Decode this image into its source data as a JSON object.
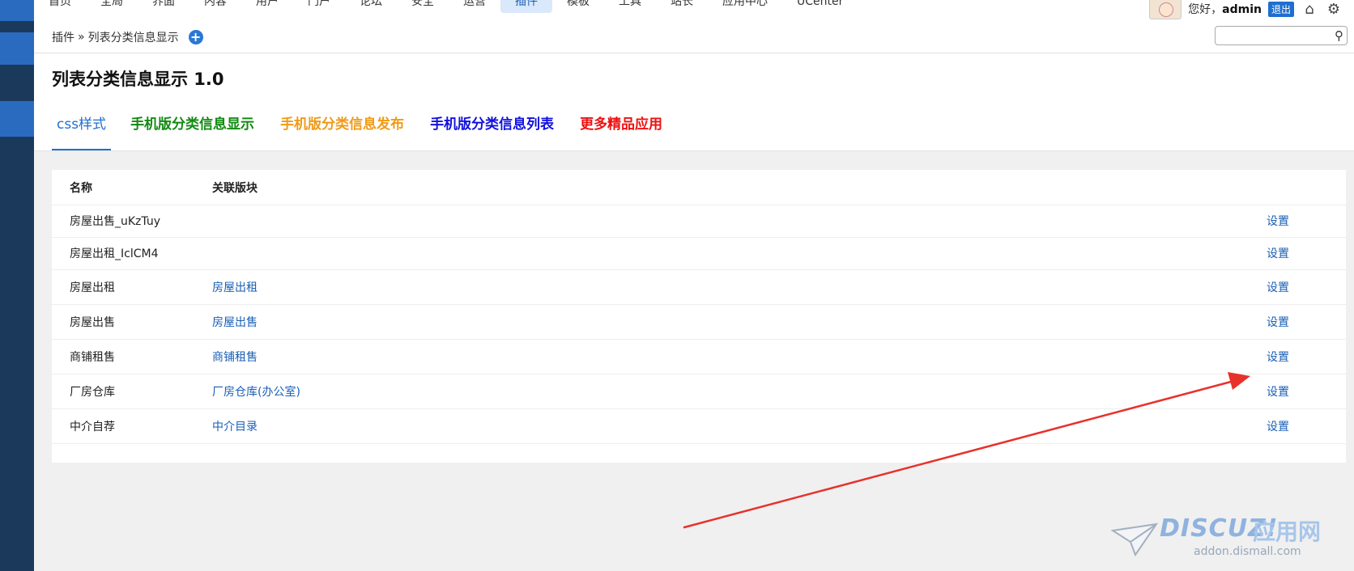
{
  "topnav": {
    "items": [
      "首页",
      "全局",
      "界面",
      "内容",
      "用户",
      "门户",
      "论坛",
      "安全",
      "运营",
      "插件",
      "模板",
      "工具",
      "站长",
      "应用中心",
      "UCenter"
    ],
    "active": "插件",
    "greeting": "您好，",
    "username": "admin",
    "logout": "退出"
  },
  "breadcrumb": {
    "parent": "插件",
    "separator": "»",
    "current": "列表分类信息显示"
  },
  "search": {
    "value": ""
  },
  "page": {
    "title": "列表分类信息显示 1.0"
  },
  "tabs": [
    {
      "label": "css样式",
      "color": "#1f6fd0"
    },
    {
      "label": "手机版分类信息显示",
      "color": "#118a11"
    },
    {
      "label": "手机版分类信息发布",
      "color": "#f09a16"
    },
    {
      "label": "手机版分类信息列表",
      "color": "#1010e0"
    },
    {
      "label": "更多精品应用",
      "color": "#ee1111"
    }
  ],
  "table": {
    "columns": [
      "名称",
      "关联版块"
    ],
    "rows": [
      {
        "name": "房屋出售_uKzTuy",
        "forum": "",
        "action": "设置"
      },
      {
        "name": "房屋出租_IclCM4",
        "forum": "",
        "action": "设置"
      },
      {
        "name": "房屋出租",
        "forum": "房屋出租",
        "action": "设置"
      },
      {
        "name": "房屋出售",
        "forum": "房屋出售",
        "action": "设置"
      },
      {
        "name": "商铺租售",
        "forum": "商铺租售",
        "action": "设置"
      },
      {
        "name": "厂房仓库",
        "forum": "厂房仓库(办公室)",
        "action": "设置"
      },
      {
        "name": "中介自荐",
        "forum": "中介目录",
        "action": "设置"
      }
    ]
  },
  "watermark": {
    "logo": "DISCUZ!",
    "cn": "应用网",
    "url": "addon.dismall.com"
  },
  "colors": {
    "sidebar": "#1b3a5b",
    "accent": "#1f6fd0",
    "arrow": "#e8312b"
  }
}
